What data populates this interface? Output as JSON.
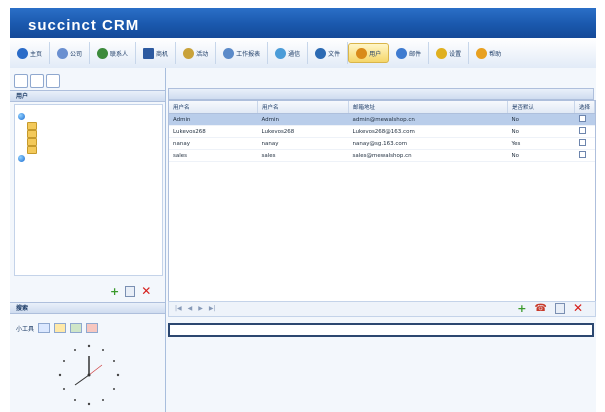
{
  "app": {
    "logo": "succinct CRM"
  },
  "topbar": {
    "links": [
      "",
      "",
      "",
      "",
      ""
    ]
  },
  "nav": {
    "items": [
      {
        "label": "主页",
        "icon": "home-icon",
        "color": "#2a6bc8"
      },
      {
        "label": "公司",
        "icon": "company-icon",
        "color": "#6a8fd0"
      },
      {
        "label": "联系人",
        "icon": "contacts-icon",
        "color": "#3c8a3b"
      },
      {
        "label": "商机",
        "icon": "opportunity-icon",
        "color": "#2d5aa0"
      },
      {
        "label": "活动",
        "icon": "activity-icon",
        "color": "#c9a23a"
      },
      {
        "label": "工作报表",
        "icon": "report-icon",
        "color": "#5b8ac9"
      },
      {
        "label": "通信",
        "icon": "communication-icon",
        "color": "#4b9cd8"
      },
      {
        "label": "文件",
        "icon": "files-icon",
        "color": "#2c6ab3"
      },
      {
        "label": "用户",
        "icon": "users-icon",
        "color": "#d98a1a",
        "active": true
      },
      {
        "label": "邮件",
        "icon": "mail-icon",
        "color": "#3f7bd0"
      },
      {
        "label": "设置",
        "icon": "settings-icon",
        "color": "#e0b020"
      },
      {
        "label": "帮助",
        "icon": "help-icon",
        "color": "#e8a020"
      }
    ]
  },
  "left": {
    "tabs": [
      "",
      "",
      ""
    ],
    "section_title": "用户",
    "tree": {
      "root": "",
      "groups": [
        "",
        "",
        "",
        ""
      ],
      "unassigned": ""
    },
    "toolbox_title": "搜索",
    "toolbox_label": "小工具"
  },
  "content": {
    "header": "",
    "columns": [
      "用户名",
      "用户名",
      "邮箱地址",
      "是否默认",
      "选择"
    ],
    "rows": [
      {
        "c1": "Admin",
        "c2": "Admin",
        "c3": "admin@mewalshop.cn",
        "c4": "No",
        "selected": true
      },
      {
        "c1": "Lukevos268",
        "c2": "Lukevos268",
        "c3": "Lukevos268@163.com",
        "c4": "No"
      },
      {
        "c1": "nanay",
        "c2": "nanay",
        "c3": "nanay@sg.163.com",
        "c4": "Yes"
      },
      {
        "c1": "sales",
        "c2": "sales",
        "c3": "sales@mewalshop.cn",
        "c4": "No"
      }
    ],
    "pager_info": "",
    "detail_label": ""
  }
}
